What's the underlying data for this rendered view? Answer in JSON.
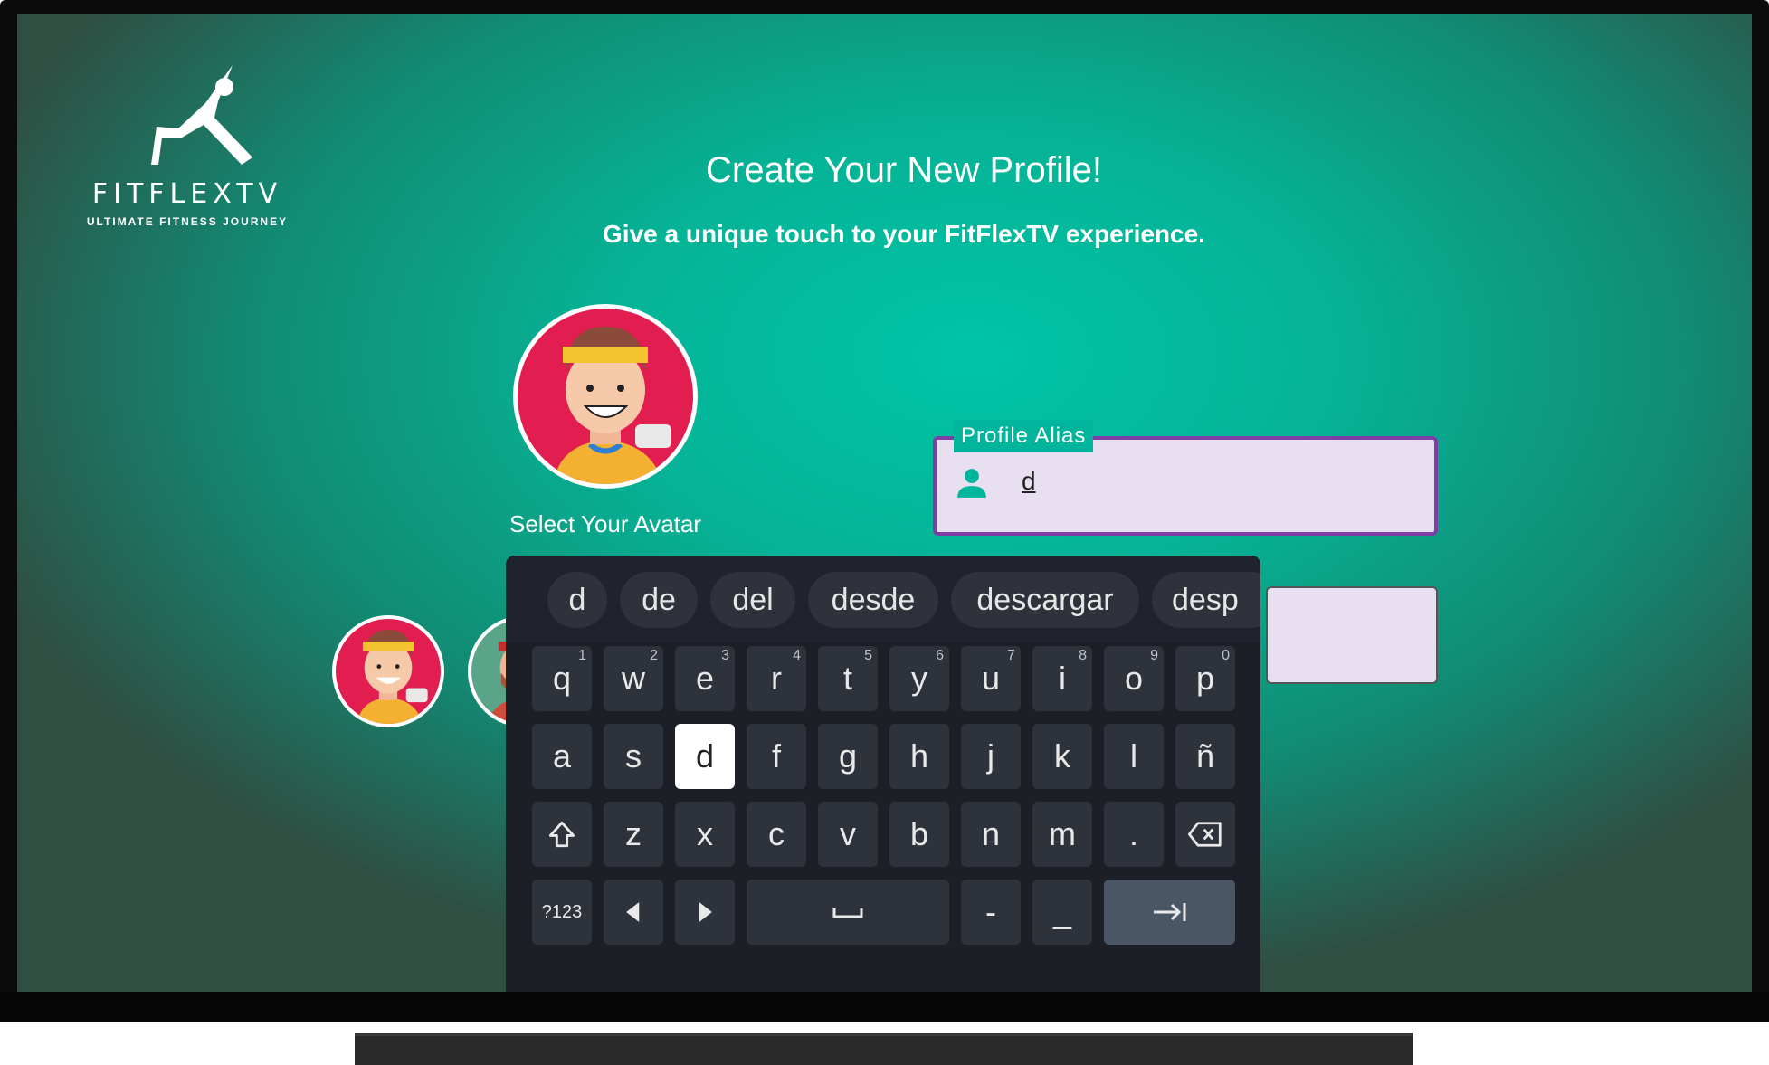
{
  "app": {
    "brand_name": "FITFLEXTV",
    "tagline": "ULTIMATE FITNESS JOURNEY",
    "title": "Create Your New Profile!",
    "subtitle": "Give a unique touch to your FitFlexTV experience."
  },
  "avatar": {
    "caption": "Select Your Avatar",
    "options": [
      "avatar-headband",
      "avatar-bearded"
    ]
  },
  "profile_alias": {
    "label": "Profile Alias",
    "value": "d",
    "icon": "person-icon"
  },
  "keyboard": {
    "suggestions": [
      "d",
      "de",
      "del",
      "desde",
      "descargar",
      "desp"
    ],
    "row1": [
      {
        "k": "q",
        "h": "1"
      },
      {
        "k": "w",
        "h": "2"
      },
      {
        "k": "e",
        "h": "3"
      },
      {
        "k": "r",
        "h": "4"
      },
      {
        "k": "t",
        "h": "5"
      },
      {
        "k": "y",
        "h": "6"
      },
      {
        "k": "u",
        "h": "7"
      },
      {
        "k": "i",
        "h": "8"
      },
      {
        "k": "o",
        "h": "9"
      },
      {
        "k": "p",
        "h": "0"
      }
    ],
    "row2": [
      "a",
      "s",
      "d",
      "f",
      "g",
      "h",
      "j",
      "k",
      "l",
      "ñ"
    ],
    "row3": [
      "z",
      "x",
      "c",
      "v",
      "b",
      "n",
      "m",
      "."
    ],
    "symbols_label": "?123",
    "dash": "-",
    "underscore": "_",
    "focused_key": "d",
    "icons": [
      "shift-icon",
      "backspace-icon",
      "arrow-left-icon",
      "arrow-right-icon",
      "space-icon",
      "tab-next-icon"
    ]
  },
  "colors": {
    "accent": "#00c4a7",
    "avatar_bg": "#e21d50",
    "field_border": "#7b3fa6",
    "keyboard_bg": "#1c1f26"
  }
}
